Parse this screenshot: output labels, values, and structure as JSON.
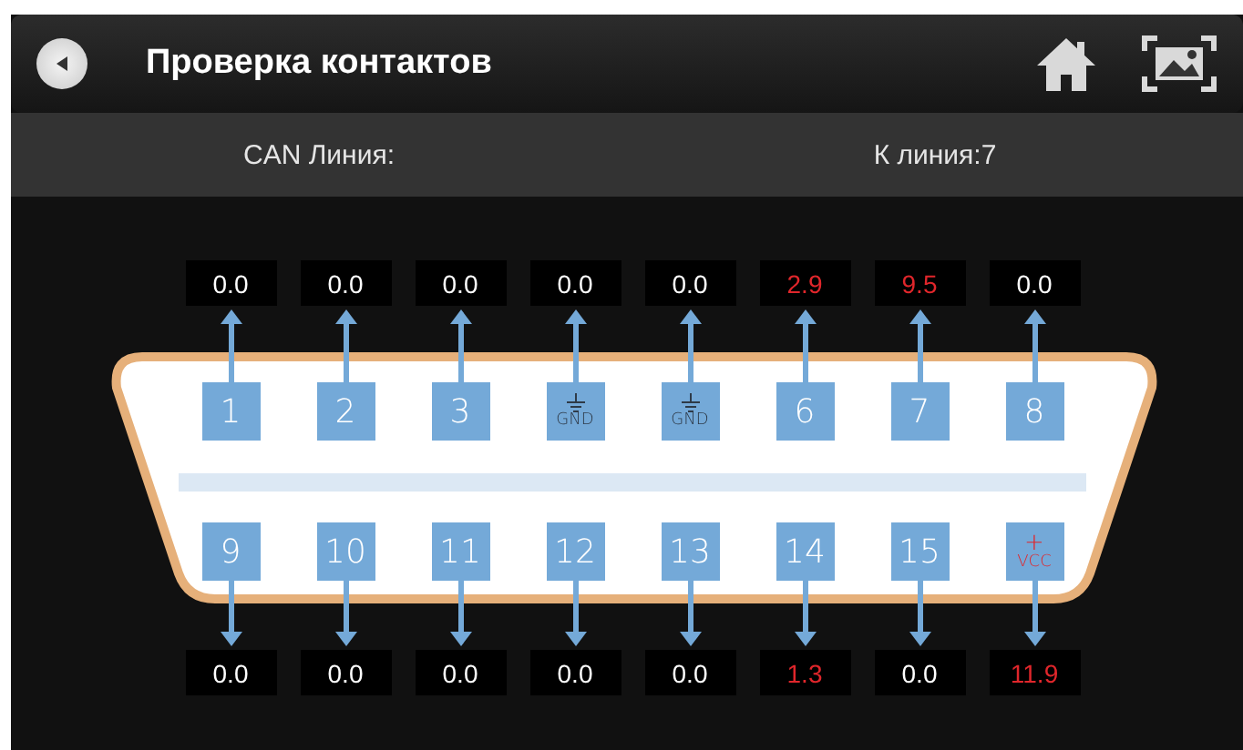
{
  "header": {
    "title": "Проверка контактов"
  },
  "info_bar": {
    "can_line": "CAN Линия:",
    "k_line": "К линия:7"
  },
  "top_readings": [
    {
      "value": "0.0",
      "color": "#ffffff"
    },
    {
      "value": "0.0",
      "color": "#ffffff"
    },
    {
      "value": "0.0",
      "color": "#ffffff"
    },
    {
      "value": "0.0",
      "color": "#ffffff"
    },
    {
      "value": "0.0",
      "color": "#ffffff"
    },
    {
      "value": "2.9",
      "color": "#e0262b"
    },
    {
      "value": "9.5",
      "color": "#e0262b"
    },
    {
      "value": "0.0",
      "color": "#ffffff"
    }
  ],
  "top_pins": [
    {
      "kind": "number",
      "label": "1"
    },
    {
      "kind": "number",
      "label": "2"
    },
    {
      "kind": "number",
      "label": "3"
    },
    {
      "kind": "ground",
      "label": "GND"
    },
    {
      "kind": "ground",
      "label": "GND"
    },
    {
      "kind": "number",
      "label": "6"
    },
    {
      "kind": "number",
      "label": "7"
    },
    {
      "kind": "number",
      "label": "8"
    }
  ],
  "bottom_pins": [
    {
      "kind": "number",
      "label": "9"
    },
    {
      "kind": "number",
      "label": "10"
    },
    {
      "kind": "number",
      "label": "11"
    },
    {
      "kind": "number",
      "label": "12"
    },
    {
      "kind": "number",
      "label": "13"
    },
    {
      "kind": "number",
      "label": "14"
    },
    {
      "kind": "number",
      "label": "15"
    },
    {
      "kind": "power",
      "symbol": "+",
      "label": "VCC"
    }
  ],
  "bottom_readings": [
    {
      "value": "0.0",
      "color": "#ffffff"
    },
    {
      "value": "0.0",
      "color": "#ffffff"
    },
    {
      "value": "0.0",
      "color": "#ffffff"
    },
    {
      "value": "0.0",
      "color": "#ffffff"
    },
    {
      "value": "0.0",
      "color": "#ffffff"
    },
    {
      "value": "1.3",
      "color": "#e0262b"
    },
    {
      "value": "0.0",
      "color": "#ffffff"
    },
    {
      "value": "11.9",
      "color": "#e0262b"
    }
  ]
}
